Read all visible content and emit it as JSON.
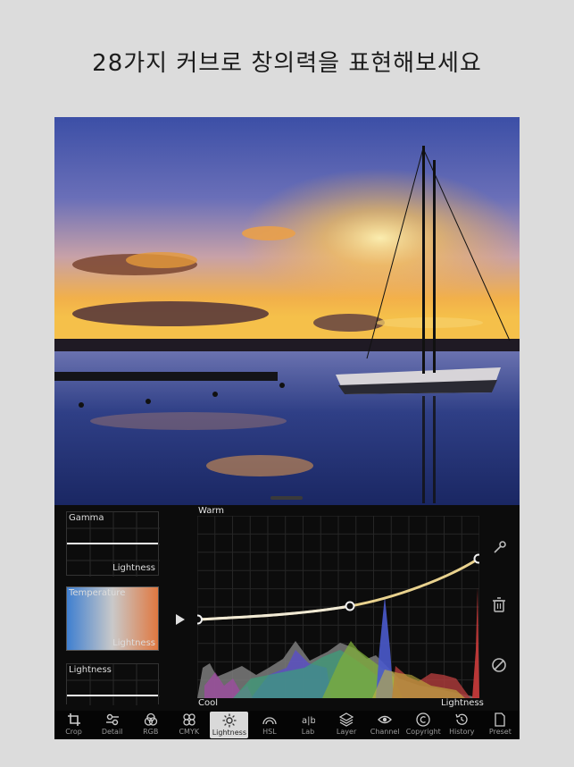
{
  "headline": "28가지 커브로 창의력을 표현해보세요",
  "thumbnails": [
    {
      "name": "Gamma",
      "sub": "Lightness"
    },
    {
      "name": "Temperature",
      "sub": "Lightness"
    },
    {
      "name": "Lightness",
      "sub": ""
    }
  ],
  "curve": {
    "top_label": "Warm",
    "bottom_left_label": "Cool",
    "bottom_right_label": "Lightness"
  },
  "side_icons": [
    "eyedropper-icon",
    "trash-icon",
    "reset-icon"
  ],
  "toolbar": [
    {
      "label": "Crop",
      "icon": "crop-icon"
    },
    {
      "label": "Detail",
      "icon": "detail-icon"
    },
    {
      "label": "RGB",
      "icon": "rgb-icon"
    },
    {
      "label": "CMYK",
      "icon": "cmyk-icon"
    },
    {
      "label": "Lightness",
      "icon": "lightness-icon",
      "active": true
    },
    {
      "label": "HSL",
      "icon": "hsl-icon"
    },
    {
      "label": "Lab",
      "icon": "lab-icon"
    },
    {
      "label": "Layer",
      "icon": "layer-icon"
    },
    {
      "label": "Channel",
      "icon": "channel-icon"
    },
    {
      "label": "Copyright",
      "icon": "copyright-icon"
    },
    {
      "label": "History",
      "icon": "history-icon"
    },
    {
      "label": "Preset",
      "icon": "preset-icon"
    }
  ],
  "colors": {
    "accent_curve": "#e6d08a",
    "background": "#dcdcdc"
  }
}
